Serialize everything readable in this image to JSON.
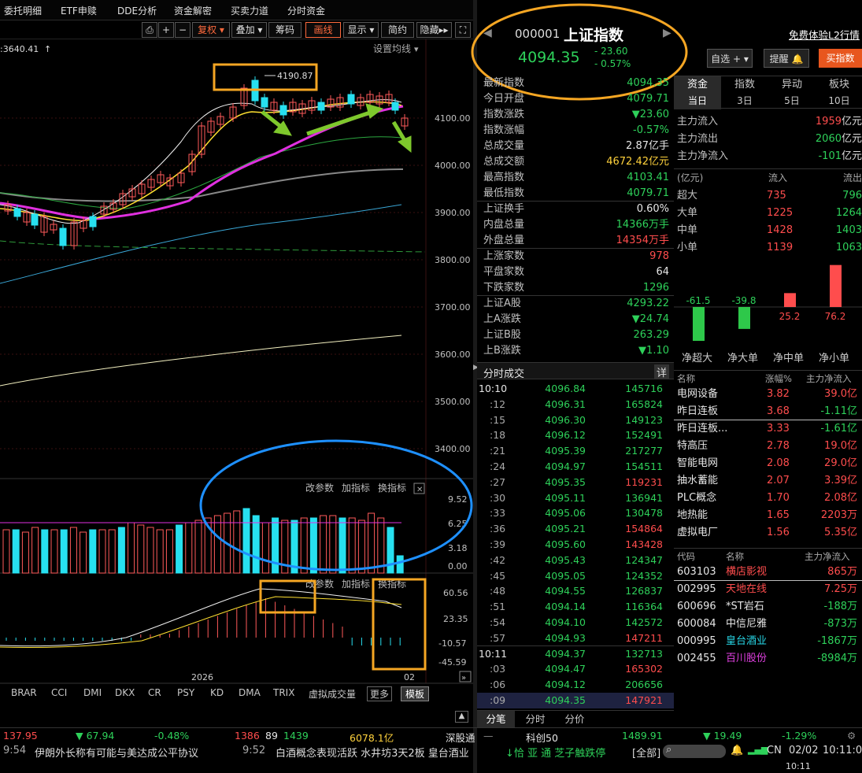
{
  "topbar": {
    "items": [
      "委托明细",
      "ETF申赎",
      "DDE分析",
      "资金解密",
      "买卖力道",
      "分时资金"
    ]
  },
  "toolbar": {
    "fuquan": "复权",
    "diejia": "叠加",
    "chouma": "筹码",
    "huaxian": "画线",
    "xianshi": "显示",
    "jianyue": "简约",
    "yincang": "隐藏"
  },
  "chart": {
    "ma_label": ":3640.41",
    "setting": "设置均线",
    "high_label": "4190.87",
    "price_ticks": [
      "4100.00",
      "4000.00",
      "3900.00",
      "3800.00",
      "3700.00",
      "3600.00",
      "3500.00",
      "3400.00"
    ],
    "vol_ticks": [
      "9.52",
      "6.25",
      "3.18",
      "0.00"
    ],
    "macd_ticks": [
      "60.56",
      "23.35",
      "-10.57",
      "-45.59"
    ],
    "panel_btns": [
      "改参数",
      "加指标",
      "换指标"
    ],
    "year": "2026",
    "month": "02",
    "indicators": [
      "BRAR",
      "CCI",
      "DMI",
      "DKX",
      "CR",
      "PSY",
      "KD",
      "DMA",
      "TRIX",
      "虚拟成交量",
      "更多",
      "模板"
    ]
  },
  "header": {
    "code": "000001",
    "name": "上证指数",
    "price": "4094.35",
    "change": "- 23.60",
    "pct": "- 0.57%"
  },
  "quote": [
    {
      "l": "最新指数",
      "v": "4094.35",
      "c": "grn"
    },
    {
      "l": "今日开盘",
      "v": "4079.71",
      "c": "grn"
    },
    {
      "l": "指数涨跌",
      "v": "▼23.60",
      "c": "grn"
    },
    {
      "l": "指数涨幅",
      "v": "-0.57%",
      "c": "grn"
    },
    {
      "l": "总成交量",
      "v": "2.87亿手",
      "c": "wht"
    },
    {
      "l": "总成交额",
      "v": "4672.42亿元",
      "c": "yel"
    },
    {
      "l": "最高指数",
      "v": "4103.41",
      "c": "grn"
    },
    {
      "l": "最低指数",
      "v": "4079.71",
      "c": "grn"
    },
    {
      "l": "上证换手",
      "v": "0.60%",
      "c": "wht"
    },
    {
      "l": "内盘总量",
      "v": "14366万手",
      "c": "grn"
    },
    {
      "l": "外盘总量",
      "v": "14354万手",
      "c": "red"
    },
    {
      "l": "上涨家数",
      "v": "978",
      "c": "red"
    },
    {
      "l": "平盘家数",
      "v": "64",
      "c": "wht"
    },
    {
      "l": "下跌家数",
      "v": "1296",
      "c": "grn"
    },
    {
      "l": "上证A股",
      "v": "4293.22",
      "c": "grn"
    },
    {
      "l": "上A涨跌",
      "v": "▼24.74",
      "c": "grn"
    },
    {
      "l": "上证B股",
      "v": "263.29",
      "c": "grn"
    },
    {
      "l": "上B涨跌",
      "v": "▼1.10",
      "c": "grn"
    }
  ],
  "ticks_title": "分时成交",
  "ticks_detail": "详",
  "ticks": [
    {
      "t": "10:10",
      "p": "4096.84",
      "q": "145716",
      "c": "grn"
    },
    {
      "t": ":12",
      "p": "4096.31",
      "q": "165824",
      "c": "grn"
    },
    {
      "t": ":15",
      "p": "4096.30",
      "q": "149123",
      "c": "grn"
    },
    {
      "t": ":18",
      "p": "4096.12",
      "q": "152491",
      "c": "grn"
    },
    {
      "t": ":21",
      "p": "4095.39",
      "q": "217277",
      "c": "grn"
    },
    {
      "t": ":24",
      "p": "4094.97",
      "q": "154511",
      "c": "grn"
    },
    {
      "t": ":27",
      "p": "4095.35",
      "q": "119231",
      "c": "red"
    },
    {
      "t": ":30",
      "p": "4095.11",
      "q": "136941",
      "c": "grn"
    },
    {
      "t": ":33",
      "p": "4095.06",
      "q": "130478",
      "c": "grn"
    },
    {
      "t": ":36",
      "p": "4095.21",
      "q": "154864",
      "c": "red"
    },
    {
      "t": ":39",
      "p": "4095.60",
      "q": "143428",
      "c": "red"
    },
    {
      "t": ":42",
      "p": "4095.43",
      "q": "124347",
      "c": "grn"
    },
    {
      "t": ":45",
      "p": "4095.05",
      "q": "124352",
      "c": "grn"
    },
    {
      "t": ":48",
      "p": "4094.55",
      "q": "126837",
      "c": "grn"
    },
    {
      "t": ":51",
      "p": "4094.14",
      "q": "116364",
      "c": "grn"
    },
    {
      "t": ":54",
      "p": "4094.10",
      "q": "142572",
      "c": "grn"
    },
    {
      "t": ":57",
      "p": "4094.93",
      "q": "147211",
      "c": "red"
    },
    {
      "t": "10:11",
      "p": "4094.37",
      "q": "132713",
      "c": "grn"
    },
    {
      "t": ":03",
      "p": "4094.47",
      "q": "165302",
      "c": "red"
    },
    {
      "t": ":06",
      "p": "4094.12",
      "q": "206656",
      "c": "grn"
    },
    {
      "t": ":09",
      "p": "4094.35",
      "q": "147921",
      "c": "red"
    }
  ],
  "tick_tabs": [
    "分笔",
    "分时",
    "分价"
  ],
  "far": {
    "free": "免费体验L2行情",
    "zixuan": "自选",
    "tixing": "提醒",
    "buy": "买指数",
    "tabs1": [
      "资金",
      "指数",
      "异动",
      "板块"
    ],
    "tabs2": [
      "当日",
      "3日",
      "5日",
      "10日"
    ],
    "flow": [
      {
        "l": "主力流入",
        "v": "1959",
        "u": "亿元",
        "c": "red"
      },
      {
        "l": "主力流出",
        "v": "2060",
        "u": "亿元",
        "c": "grn"
      },
      {
        "l": "主力净流入",
        "v": "-101",
        "u": "亿元",
        "c": "grn"
      }
    ],
    "tbl_head": [
      "(亿元)",
      "流入",
      "流出"
    ],
    "tbl": [
      {
        "l": "超大",
        "a": "735",
        "b": "796"
      },
      {
        "l": "大单",
        "a": "1225",
        "b": "1264"
      },
      {
        "l": "中单",
        "a": "1428",
        "b": "1403"
      },
      {
        "l": "小单",
        "a": "1139",
        "b": "1063"
      }
    ],
    "bars": [
      {
        "l": "净超大",
        "v": "-61.5"
      },
      {
        "l": "净大单",
        "v": "-39.8"
      },
      {
        "l": "净中单",
        "v": "25.2"
      },
      {
        "l": "净小单",
        "v": "76.2"
      }
    ],
    "sect_head": [
      "名称",
      "涨幅%",
      "主力净流入"
    ],
    "sectors": [
      {
        "n": "电网设备",
        "p": "3.82",
        "f": "39.0亿",
        "fc": "red"
      },
      {
        "n": "昨日连板",
        "p": "3.68",
        "f": "-1.11亿",
        "fc": "grn"
      },
      {
        "n": "昨日连板...",
        "p": "3.33",
        "f": "-1.61亿",
        "fc": "grn"
      },
      {
        "n": "特高压",
        "p": "2.78",
        "f": "19.0亿",
        "fc": "red"
      },
      {
        "n": "智能电网",
        "p": "2.08",
        "f": "29.0亿",
        "fc": "red"
      },
      {
        "n": "抽水蓄能",
        "p": "2.07",
        "f": "3.39亿",
        "fc": "red"
      },
      {
        "n": "PLC概念",
        "p": "1.70",
        "f": "2.08亿",
        "fc": "red"
      },
      {
        "n": "地热能",
        "p": "1.65",
        "f": "2203万",
        "fc": "red"
      },
      {
        "n": "虚拟电厂",
        "p": "1.56",
        "f": "5.35亿",
        "fc": "red"
      }
    ],
    "stock_head": [
      "代码",
      "名称",
      "主力净流入"
    ],
    "stocks": [
      {
        "c": "603103",
        "n": "横店影视",
        "f": "865万",
        "nc": "red",
        "fc": "red"
      },
      {
        "c": "002995",
        "n": "天地在线",
        "f": "7.25万",
        "nc": "red",
        "fc": "red"
      },
      {
        "c": "600696",
        "n": "*ST岩石",
        "f": "-188万",
        "nc": "wht",
        "fc": "grn"
      },
      {
        "c": "600084",
        "n": "中信尼雅",
        "f": "-873万",
        "nc": "wht",
        "fc": "grn"
      },
      {
        "c": "000995",
        "n": "皇台酒业",
        "f": "-1867万",
        "nc": "cyan",
        "fc": "grn"
      },
      {
        "c": "002455",
        "n": "百川股份",
        "f": "-8984万",
        "nc": "mag",
        "fc": "grn"
      }
    ]
  },
  "status": {
    "a": "137.95",
    "b": "▼ 67.94",
    "c": "-0.48%",
    "d": "1386",
    "e": "89",
    "f": "1439",
    "g": "6078.1亿",
    "h": "深股通",
    "i": "科创50",
    "j": "1489.91",
    "k": "▼ 19.49",
    "l": "-1.29%"
  },
  "news": {
    "t1": "9:54",
    "n1": "伊朗外长称有可能与美达成公平协议",
    "t2": "9:52",
    "n2": "白酒概念表现活跃 水井坊3天2板 皇台酒业",
    "n3": "↓恰 亚 通 芝子触跌停",
    "all": "[全部]",
    "cn": "CN",
    "date": "02/02",
    "time": "10:11:0",
    "clock": "10:11"
  }
}
